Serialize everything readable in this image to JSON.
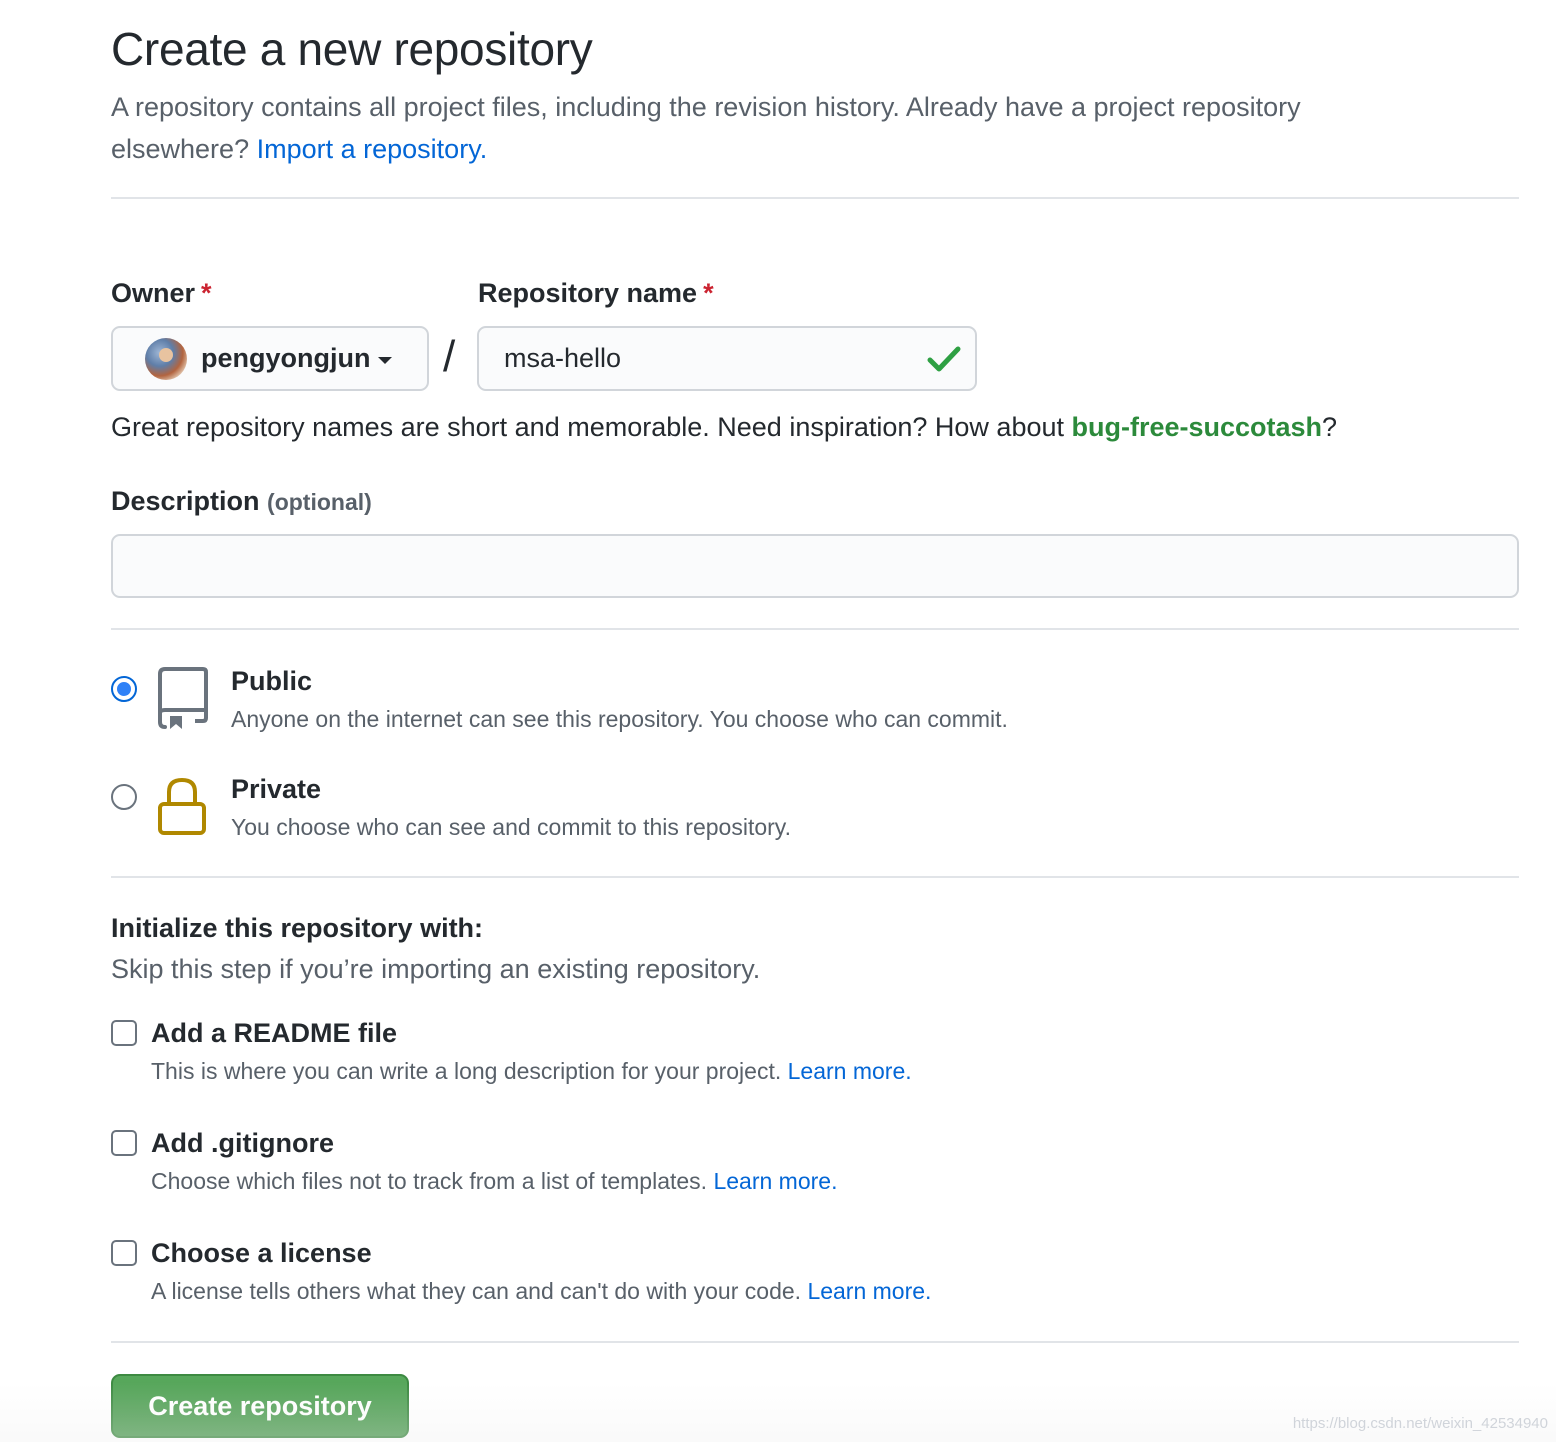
{
  "header": {
    "title": "Create a new repository",
    "subtitle_text": "A repository contains all project files, including the revision history. Already have a project repository elsewhere?",
    "import_link": "Import a repository."
  },
  "owner": {
    "label": "Owner",
    "required_mark": "*",
    "value": "pengyongjun",
    "avatar_icon": "user-avatar"
  },
  "separator": "/",
  "repo_name": {
    "label": "Repository name",
    "required_mark": "*",
    "value": "msa-hello",
    "status_icon": "check-icon",
    "status_color": "#28a745"
  },
  "hint": {
    "text_before": "Great repository names are short and memorable. Need inspiration? How about ",
    "suggestion": "bug-free-succotash",
    "text_after": "?"
  },
  "description": {
    "label": "Description",
    "optional_label": "(optional)",
    "value": ""
  },
  "visibility": {
    "selected": "public",
    "options": [
      {
        "key": "public",
        "title": "Public",
        "desc": "Anyone on the internet can see this repository. You choose who can commit.",
        "icon": "repo-icon"
      },
      {
        "key": "private",
        "title": "Private",
        "desc": "You choose who can see and commit to this repository.",
        "icon": "lock-icon",
        "icon_color": "#b08800"
      }
    ]
  },
  "initialize": {
    "title": "Initialize this repository with:",
    "subtitle": "Skip this step if you’re importing an existing repository.",
    "options": [
      {
        "title": "Add a README file",
        "desc": "This is where you can write a long description for your project.",
        "link": "Learn more.",
        "checked": false
      },
      {
        "title": "Add .gitignore",
        "desc": "Choose which files not to track from a list of templates.",
        "link": "Learn more.",
        "checked": false
      },
      {
        "title": "Choose a license",
        "desc": "A license tells others what they can and can't do with your code.",
        "link": "Learn more.",
        "checked": false
      }
    ]
  },
  "submit": {
    "label": "Create repository",
    "color": "#4c9a50"
  },
  "watermark": "https://blog.csdn.net/weixin_42534940"
}
